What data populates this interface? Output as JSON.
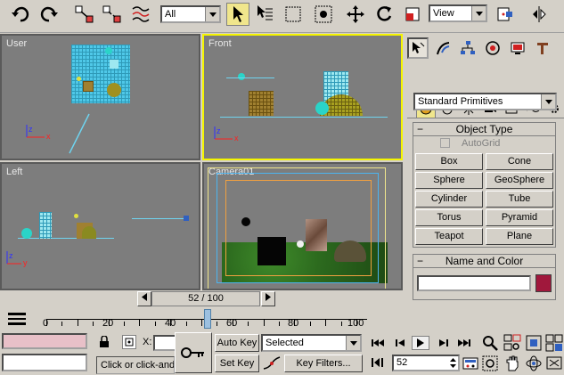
{
  "toolbar": {
    "selection_filter": "All",
    "coord_system": "View",
    "icons": [
      "undo-icon",
      "redo-icon",
      "select-link-icon",
      "unlink-icon",
      "bind-space-warp-icon",
      "select-object-icon",
      "select-by-name-icon",
      "rect-selection-region-icon",
      "window-crossing-icon",
      "select-move-icon",
      "select-rotate-icon",
      "select-scale-icon",
      "use-pivot-center-icon",
      "mirror-icon"
    ]
  },
  "viewports": {
    "top_left": {
      "label": "User"
    },
    "top_right": {
      "label": "Front"
    },
    "bottom_left": {
      "label": "Left"
    },
    "bottom_right": {
      "label": "Camera01"
    }
  },
  "command_panel": {
    "category": "Standard Primitives",
    "object_type": {
      "title": "Object Type",
      "autogrid_label": "AutoGrid",
      "buttons": [
        "Box",
        "Cone",
        "Sphere",
        "GeoSphere",
        "Cylinder",
        "Tube",
        "Torus",
        "Pyramid",
        "Teapot",
        "Plane"
      ]
    },
    "name_and_color": {
      "title": "Name and Color",
      "name_value": "",
      "color": "#a0183c"
    },
    "rollout_toggle": "−"
  },
  "time_slider": {
    "label": "52 / 100",
    "current_frame": 52,
    "total_frames": 100
  },
  "track_bar": {
    "tick_labels": [
      "0",
      "20",
      "40",
      "60",
      "80",
      "100"
    ]
  },
  "status": {
    "prompt": "Click or click-and",
    "x_label": "X:"
  },
  "animation": {
    "auto_key": "Auto Key",
    "set_key": "Set Key",
    "key_filter_dropdown": "Selected",
    "key_filters": "Key Filters...",
    "frame_value": "52"
  },
  "colors": {
    "viewport_bg": "#7d7d7d",
    "active_border": "#f5f500",
    "ui_bg": "#d4d0c8",
    "selection_highlight": "#f0e68c"
  }
}
